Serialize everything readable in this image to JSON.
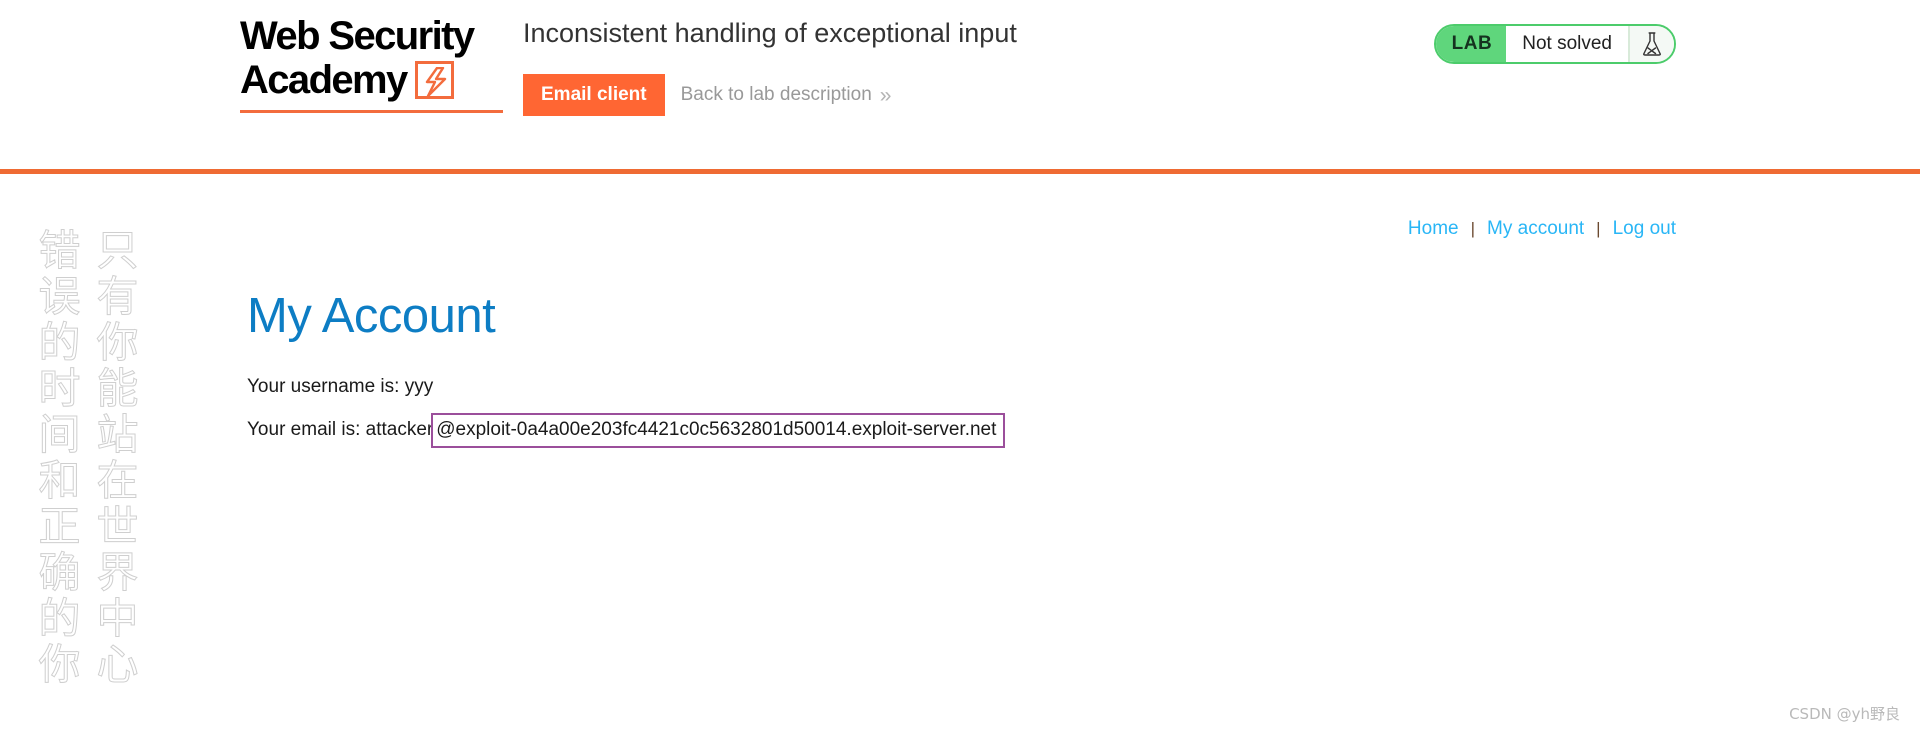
{
  "header": {
    "logo": {
      "line1": "Web Security",
      "line2": "Academy",
      "mark_icon": "lightning-bolt-icon"
    },
    "lab_title": "Inconsistent handling of exceptional input",
    "email_client_button": "Email client",
    "back_link": "Back to lab description",
    "back_link_chevron": "»",
    "status": {
      "tag": "LAB",
      "state": "Not solved",
      "icon": "flask-not-solved-icon",
      "accent_color": "#5fd67c",
      "border_color": "#4ccc6b"
    },
    "rule_color": "#ef6b33"
  },
  "account_nav": {
    "items": [
      {
        "label": "Home"
      },
      {
        "label": "My account"
      },
      {
        "label": "Log out"
      }
    ],
    "separator": "|",
    "link_color": "#29b6f6"
  },
  "main": {
    "heading": "My Account",
    "username_label": "Your username is:",
    "username_value": "yyy",
    "email_label": "Your email is:",
    "email_local_prefix": "attacker",
    "email_highlighted": "@exploit-0a4a00e203fc4421c0c5632801d50014.exploit-server.net",
    "email_highlight_color": "#9b4f9b"
  },
  "watermarks": {
    "vertical_right": "只有你能站在世界中心",
    "vertical_left": "错误的时间和正确的你",
    "csdn": "CSDN @yh野良"
  }
}
